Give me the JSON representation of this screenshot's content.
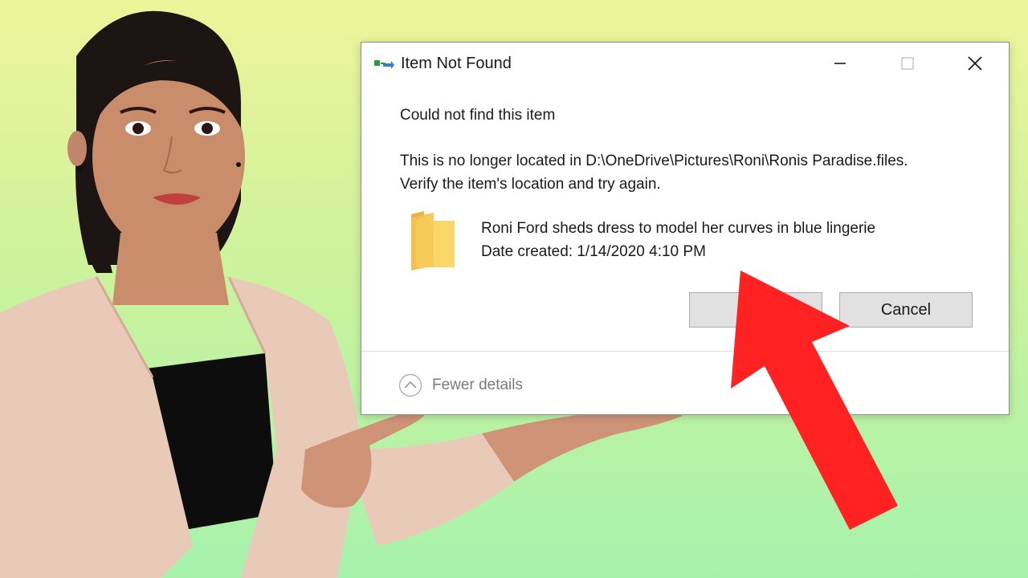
{
  "dialog": {
    "title": "Item Not Found",
    "heading": "Could not find this item",
    "message_line1": "This is no longer located in D:\\OneDrive\\Pictures\\Roni\\Ronis Paradise.files.",
    "message_line2": "Verify the item's location and try again.",
    "item": {
      "name": "Roni Ford sheds dress to model her curves in blue lingerie",
      "date_created": "Date created: 1/14/2020 4:10 PM"
    },
    "buttons": {
      "try_again_visible": "Try",
      "cancel": "Cancel"
    },
    "details_toggle": "Fewer details"
  },
  "colors": {
    "arrow": "#ff2222",
    "background_top": "#eef49a",
    "background_bottom": "#a6f2ad"
  },
  "icons": {
    "app": "file-move-icon",
    "folder": "folder-icon",
    "details": "chevron-up-circle-icon"
  }
}
